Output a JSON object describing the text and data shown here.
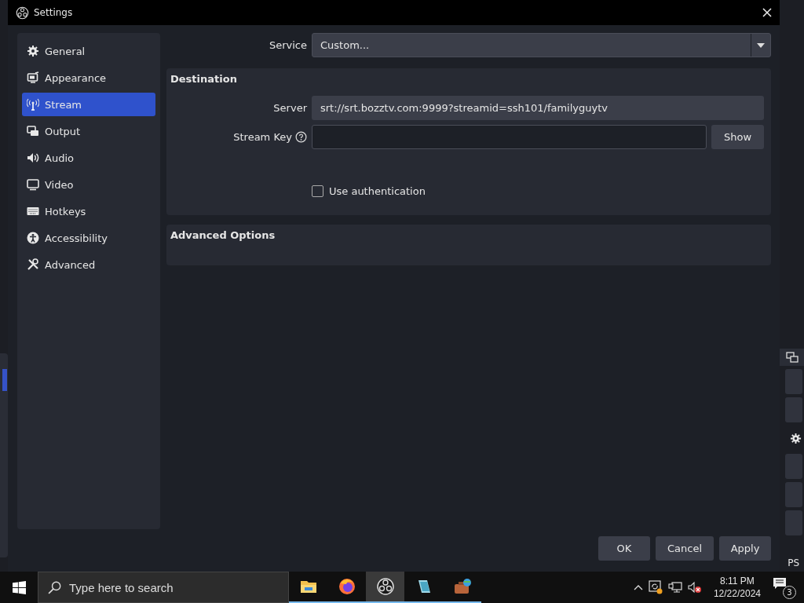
{
  "window": {
    "title": "Settings"
  },
  "sidebar": {
    "items": [
      {
        "label": "General",
        "selected": false
      },
      {
        "label": "Appearance",
        "selected": false
      },
      {
        "label": "Stream",
        "selected": true
      },
      {
        "label": "Output",
        "selected": false
      },
      {
        "label": "Audio",
        "selected": false
      },
      {
        "label": "Video",
        "selected": false
      },
      {
        "label": "Hotkeys",
        "selected": false
      },
      {
        "label": "Accessibility",
        "selected": false
      },
      {
        "label": "Advanced",
        "selected": false
      }
    ]
  },
  "service": {
    "label": "Service",
    "value": "Custom..."
  },
  "destination": {
    "title": "Destination",
    "server_label": "Server",
    "server": "srt://srt.bozztv.com:9999?streamid=ssh101/familyguytv",
    "key_label": "Stream Key",
    "show_button": "Show",
    "use_auth": {
      "label": "Use authentication",
      "checked": false
    }
  },
  "advanced": {
    "title": "Advanced Options"
  },
  "buttons": [
    "OK",
    "Cancel",
    "Apply"
  ],
  "background": {
    "status_text": "PS"
  },
  "taskbar": {
    "search_placeholder": "Type here to search",
    "apps": [
      {
        "selected": false
      },
      {
        "selected": false
      },
      {
        "selected": true
      },
      {
        "selected": false
      },
      {
        "selected": false
      }
    ],
    "time": "8:11 PM",
    "date": "12/22/2024",
    "notifications": "3"
  }
}
